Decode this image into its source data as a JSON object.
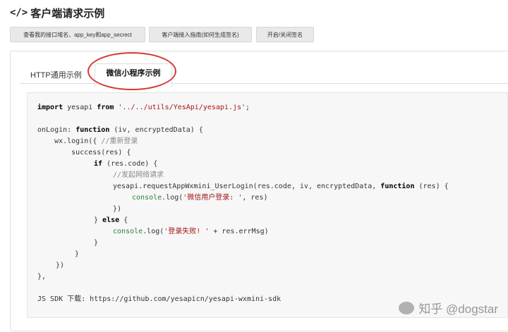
{
  "header": {
    "icon": "</>",
    "title": "客户端请求示例"
  },
  "buttons": [
    "查看我的接口域名、app_key和app_secrect",
    "客户端接入指南(如何生成签名)",
    "开启/关闭签名"
  ],
  "tabs": {
    "http": "HTTP通用示例",
    "wx": "微信小程序示例"
  },
  "code": {
    "l1_kw1": "import",
    "l1_mid": " yesapi ",
    "l1_kw2": "from",
    "l1_sp": " ",
    "l1_str": "'../../utils/YesApi/yesapi.js'",
    "l1_end": ";",
    "l2_pre": "onLogin: ",
    "l2_kw": "function",
    "l2_post": " (iv, encryptedData) {",
    "l3_pre": "    wx.login({ ",
    "l3_cmt": "//重新登录",
    "l4": "        success(res) {",
    "l5_kw": "if",
    "l5_post": " (res.code) {",
    "l6_cmt": "//发起网络请求",
    "l7_pre": "yesapi.requestAppWxmini_UserLogin(res.code, iv, encryptedData, ",
    "l7_kw": "function",
    "l7_post": " (res) {",
    "l8_fn": "console",
    "l8_mid": ".log(",
    "l8_str": "'微信用户登录: '",
    "l8_post": ", res)",
    "l9": "})",
    "l10_pre": "} ",
    "l10_kw": "else",
    "l10_post": " {",
    "l11_fn": "console",
    "l11_mid": ".log(",
    "l11_str": "'登录失败! '",
    "l11_post": " + res.errMsg)",
    "l12": "}",
    "l13": "}",
    "l14": "})",
    "l15": "},",
    "l16": "JS SDK 下载: https://github.com/yesapicn/yesapi-wxmini-sdk"
  },
  "watermark": "知乎 @dogstar"
}
